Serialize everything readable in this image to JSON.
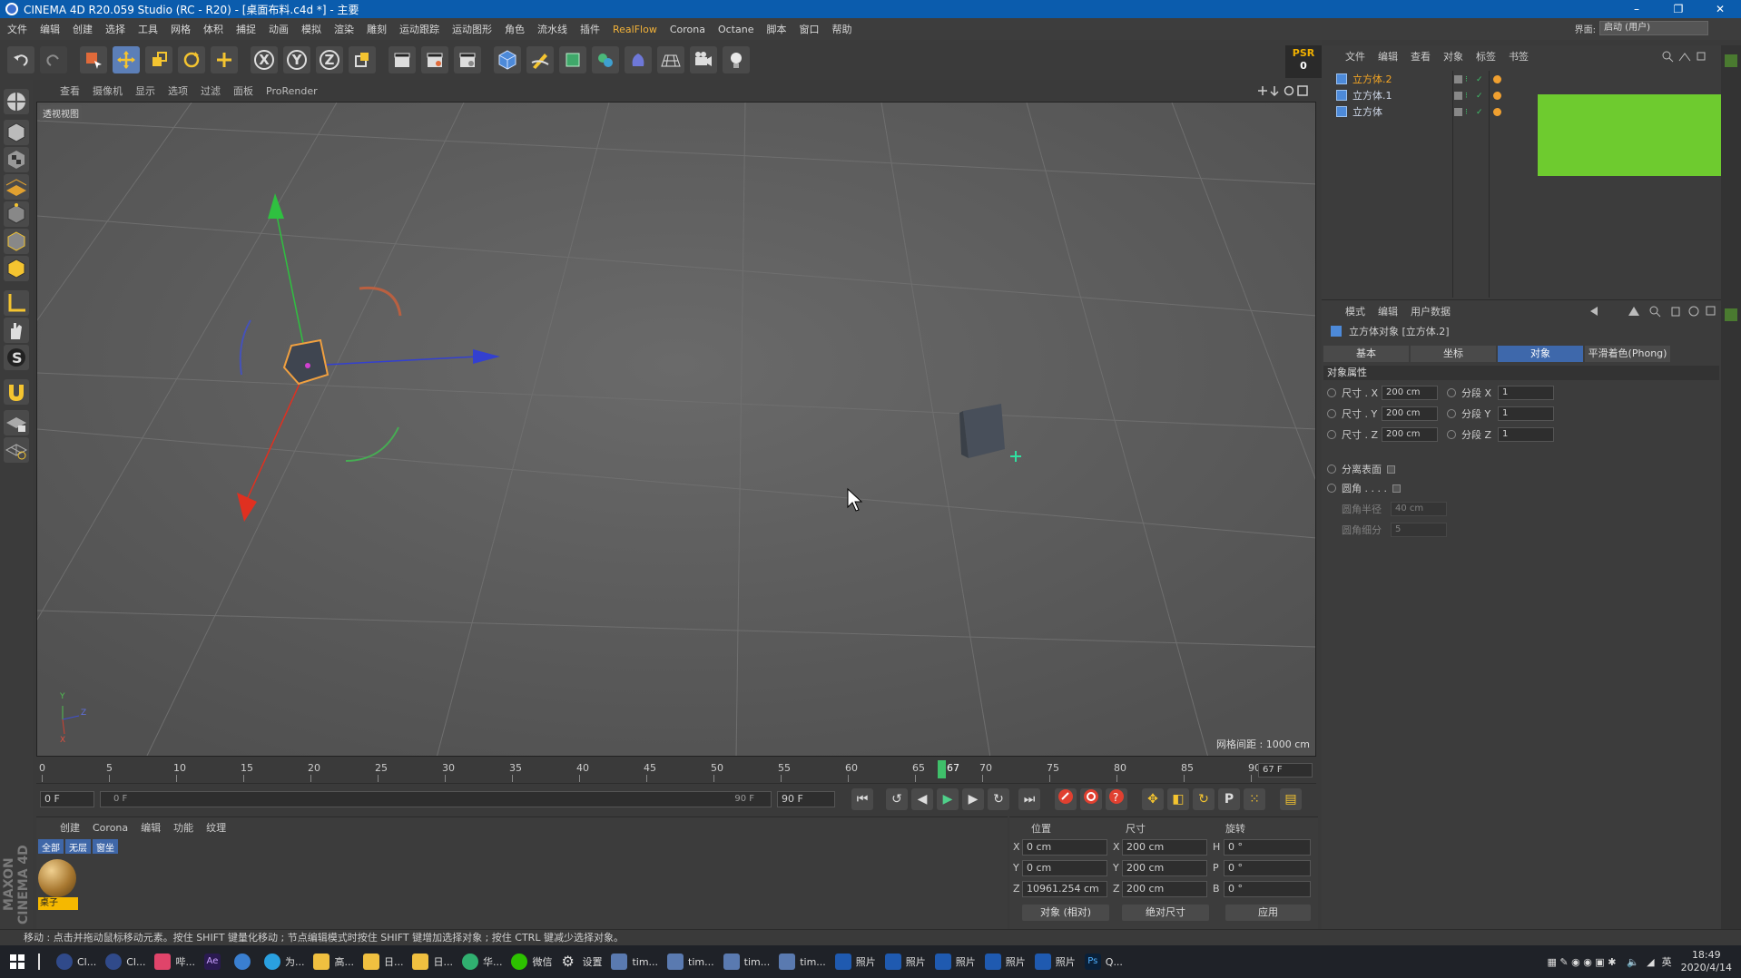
{
  "window": {
    "title": "CINEMA 4D R20.059 Studio (RC - R20) - [桌面布料.c4d *] - 主要",
    "minimize": "–",
    "maximize": "❐",
    "close": "✕"
  },
  "menubar": {
    "items": [
      "文件",
      "编辑",
      "创建",
      "选择",
      "工具",
      "网格",
      "体积",
      "捕捉",
      "动画",
      "模拟",
      "渲染",
      "雕刻",
      "运动跟踪",
      "运动图形",
      "角色",
      "流水线",
      "插件",
      "RealFlow",
      "Corona",
      "Octane",
      "脚本",
      "窗口",
      "帮助"
    ],
    "layout_label": "界面:",
    "layout_value": "启动 (用户)"
  },
  "toolbar": {
    "psr_label": "PSR",
    "psr_value": "0",
    "axis_x": "X",
    "axis_y": "Y",
    "axis_z": "Z"
  },
  "viewport": {
    "menu": [
      "查看",
      "摄像机",
      "显示",
      "选项",
      "过滤",
      "面板",
      "ProRender"
    ],
    "label": "透视视图",
    "grid_spacing": "网格间距 : 1000 cm",
    "axis_y": "Y",
    "axis_z": "Z",
    "axis_x": "X"
  },
  "timeline": {
    "ticks": [
      "0",
      "5",
      "10",
      "15",
      "20",
      "25",
      "30",
      "35",
      "40",
      "45",
      "50",
      "55",
      "60",
      "65",
      "70",
      "75",
      "80",
      "85",
      "90"
    ],
    "current_frame": "67",
    "current_field": "67 F",
    "start_field": "0 F",
    "range_start": "0 F",
    "range_end": "90 F",
    "end_field": "90 F",
    "current_fraction": 0.744
  },
  "materials": {
    "menu": [
      "创建",
      "Corona",
      "编辑",
      "功能",
      "纹理"
    ],
    "filters": [
      "全部",
      "无层",
      "窗坐"
    ],
    "items": [
      {
        "name": "桌子"
      }
    ]
  },
  "coords": {
    "headers": [
      "位置",
      "尺寸",
      "旋转"
    ],
    "rows": [
      {
        "axis": "X",
        "pos": "0 cm",
        "size_axis": "X",
        "size": "200 cm",
        "rot_axis": "H",
        "rot": "0 °"
      },
      {
        "axis": "Y",
        "pos": "0 cm",
        "size_axis": "Y",
        "size": "200 cm",
        "rot_axis": "P",
        "rot": "0 °"
      },
      {
        "axis": "Z",
        "pos": "10961.254 cm",
        "size_axis": "Z",
        "size": "200 cm",
        "rot_axis": "B",
        "rot": "0 °"
      }
    ],
    "mode": "对象 (相对)",
    "size_mode": "绝对尺寸",
    "apply": "应用"
  },
  "object_manager": {
    "menu": [
      "文件",
      "编辑",
      "查看",
      "对象",
      "标签",
      "书签"
    ],
    "objects": [
      {
        "name": "立方体.2",
        "selected": true
      },
      {
        "name": "立方体.1",
        "selected": false
      },
      {
        "name": "立方体",
        "selected": false
      }
    ]
  },
  "attributes": {
    "menu": [
      "模式",
      "编辑",
      "用户数据"
    ],
    "title": "立方体对象 [立方体.2]",
    "tabs": [
      "基本",
      "坐标",
      "对象",
      "平滑着色(Phong)"
    ],
    "active_tab": "对象",
    "section": "对象属性",
    "rows": [
      {
        "label": "尺寸 . X",
        "value": "200 cm",
        "seg_label": "分段 X",
        "seg": "1"
      },
      {
        "label": "尺寸 . Y",
        "value": "200 cm",
        "seg_label": "分段 Y",
        "seg": "1"
      },
      {
        "label": "尺寸 . Z",
        "value": "200 cm",
        "seg_label": "分段 Z",
        "seg": "1"
      }
    ],
    "separate_surfaces": "分离表面",
    "fillet": "圆角 . . . .",
    "fillet_radius_label": "圆角半径",
    "fillet_radius": "40 cm",
    "fillet_subdiv_label": "圆角细分",
    "fillet_subdiv": "5"
  },
  "status": {
    "text": "移动 : 点击并拖动鼠标移动元素。按住 SHIFT 键量化移动 ; 节点编辑模式时按住 SHIFT 键增加选择对象 ; 按住 CTRL 键减少选择对象。"
  },
  "taskbar": {
    "items": [
      "Cl...",
      "Cl...",
      "哔...",
      "",
      "",
      "为...",
      "高...",
      "日...",
      "日...",
      "华...",
      "微信",
      "设置",
      "tim...",
      "tim...",
      "tim...",
      "tim...",
      "照片",
      "照片",
      "照片",
      "照片",
      "照片",
      "Q..."
    ],
    "time": "18:49",
    "date": "2020/4/14",
    "ime": "英"
  },
  "colors": {
    "accent_blue": "#3e68ab",
    "selected_object": "#f5a623",
    "playhead": "#3fc06a",
    "green_box": "#6ecb2f"
  }
}
